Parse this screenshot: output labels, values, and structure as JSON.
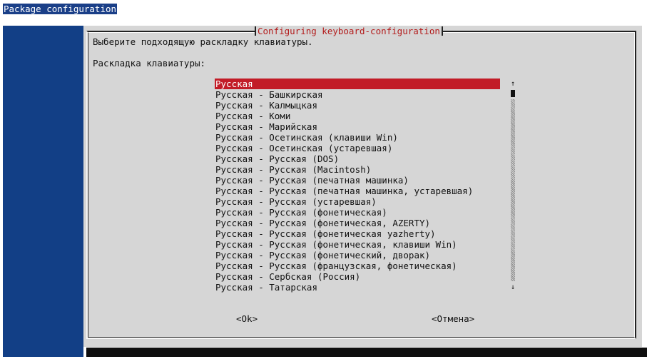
{
  "window": {
    "title": "Package configuration"
  },
  "dialog": {
    "title": "Configuring keyboard-configuration",
    "prompt": "Выберите подходящую раскладку клавиатуры.",
    "label": "Раскладка клавиатуры:",
    "selected_index": 0,
    "items": [
      "Русская",
      "Русская - Башкирская",
      "Русская - Калмыцкая",
      "Русская - Коми",
      "Русская - Марийская",
      "Русская - Осетинская (клавиши Win)",
      "Русская - Осетинская (устаревшая)",
      "Русская - Русская (DOS)",
      "Русская - Русская (Macintosh)",
      "Русская - Русская (печатная машинка)",
      "Русская - Русская (печатная машинка, устаревшая)",
      "Русская - Русская (устаревшая)",
      "Русская - Русская (фонетическая)",
      "Русская - Русская (фонетическая, AZERTY)",
      "Русская - Русская (фонетическая yazherty)",
      "Русская - Русская (фонетическая, клавиши Win)",
      "Русская - Русская (фонетический, дворак)",
      "Русская - Русская (французская, фонетическая)",
      "Русская - Сербская (Россия)",
      "Русская - Татарская"
    ],
    "scroll_up_glyph": "↑",
    "scroll_down_glyph": "↓",
    "buttons": {
      "ok": "<Ok>",
      "cancel": "<Отмена>"
    }
  },
  "colors": {
    "title_bar": "#1a3f88",
    "backdrop": "#123f86",
    "dialog_bg": "#d6d6d6",
    "dialog_title": "#b31b1b",
    "selection": "#c21c27"
  }
}
